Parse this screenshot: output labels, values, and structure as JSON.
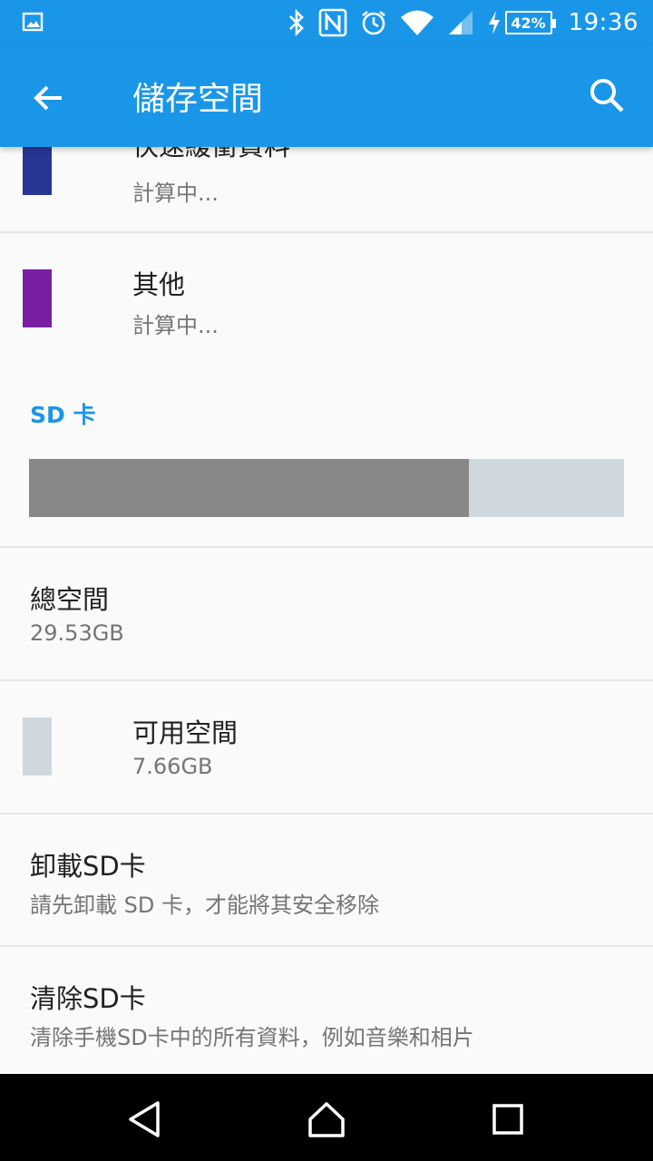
{
  "status_bar": {
    "left_icon": "image-notification-icon",
    "icons": [
      "bluetooth-icon",
      "nfc-icon",
      "alarm-icon",
      "wifi-icon",
      "signal-icon",
      "charging-icon"
    ],
    "battery": "42%",
    "time": "19:36"
  },
  "app_bar": {
    "title": "儲存空間",
    "back_icon": "back-arrow-icon",
    "search_icon": "search-icon",
    "color": "#1a96e8"
  },
  "internal_items": [
    {
      "title": "快速緩衝資料",
      "subtitle": "計算中...",
      "swatch_color": "#283593"
    },
    {
      "title": "其他",
      "subtitle": "計算中...",
      "swatch_color": "#7b1fa2"
    }
  ],
  "sd_card": {
    "header": "SD 卡",
    "used_fraction": 0.74,
    "used_color": "#888888",
    "free_color": "#cfd8dc",
    "total": {
      "title": "總空間",
      "value": "29.53GB"
    },
    "available": {
      "title": "可用空間",
      "value": "7.66GB",
      "swatch_color": "#cfd8dc"
    },
    "unmount": {
      "title": "卸載SD卡",
      "subtitle": "請先卸載 SD 卡，才能將其安全移除"
    },
    "erase": {
      "title": "清除SD卡",
      "subtitle": "清除手機SD卡中的所有資料，例如音樂和相片"
    }
  },
  "nav_bar": {
    "back": "back-triangle-icon",
    "home": "home-icon",
    "recents": "recents-square-icon"
  }
}
